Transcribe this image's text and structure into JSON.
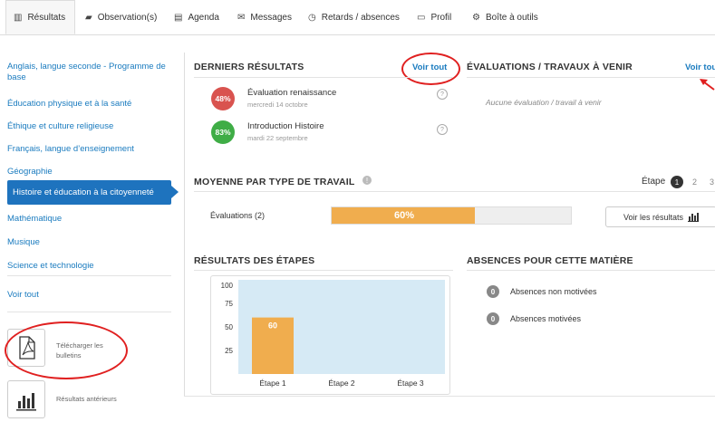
{
  "tabs": [
    {
      "label": "Résultats",
      "icon": "bar-chart-icon"
    },
    {
      "label": "Observation(s)",
      "icon": "folder-icon"
    },
    {
      "label": "Agenda",
      "icon": "calendar-icon"
    },
    {
      "label": "Messages",
      "icon": "envelope-icon"
    },
    {
      "label": "Retards / absences",
      "icon": "clock-icon"
    },
    {
      "label": "Profil",
      "icon": "id-card-icon"
    },
    {
      "label": "Boîte à outils",
      "icon": "tools-icon"
    }
  ],
  "sidebar": {
    "items": [
      {
        "label": "Anglais, langue seconde - Programme de base"
      },
      {
        "label": "Éducation physique et à la santé"
      },
      {
        "label": "Éthique et culture religieuse"
      },
      {
        "label": "Français, langue d’enseignement"
      },
      {
        "label": "Géographie"
      },
      {
        "label": "Histoire et éducation à la citoyenneté"
      },
      {
        "label": "Mathématique"
      },
      {
        "label": "Musique"
      },
      {
        "label": "Science et technologie"
      }
    ],
    "see_all": "Voir tout",
    "download_label": "Télécharger les bulletins",
    "previous_label": "Résultats antérieurs"
  },
  "recent": {
    "title": "DERNIERS RÉSULTATS",
    "see_all": "Voir tout",
    "items": [
      {
        "score": "48%",
        "title": "Évaluation renaissance",
        "date": "mercredi 14 octobre",
        "color": "#d9534f"
      },
      {
        "score": "83%",
        "title": "Introduction Histoire",
        "date": "mardi 22 septembre",
        "color": "#3fad46"
      }
    ]
  },
  "upcoming": {
    "title": "ÉVALUATIONS / TRAVAUX À VENIR",
    "see_all": "Voir tout",
    "empty": "Aucune évaluation / travail à venir"
  },
  "average": {
    "title": "MOYENNE PAR TYPE DE TRAVAIL",
    "step_label": "Étape",
    "steps": [
      "1",
      "2",
      "3"
    ],
    "row_label": "Évaluations (2)",
    "percent_text": "60%",
    "percent": 0.6,
    "view_button": "Voir les résultats",
    "bar_color": "#f0ad4e"
  },
  "stages": {
    "title": "RÉSULTATS DES ÉTAPES"
  },
  "absences": {
    "title": "ABSENCES POUR CETTE MATIÈRE",
    "unexcused_count": "0",
    "unexcused_label": "Absences non motivées",
    "excused_count": "0",
    "excused_label": "Absences motivées"
  },
  "chart_data": {
    "type": "bar",
    "categories": [
      "Étape 1",
      "Étape 2",
      "Étape 3"
    ],
    "values": [
      60,
      null,
      null
    ],
    "value_labels": [
      "60",
      "",
      ""
    ],
    "yticks": [
      "100",
      "75",
      "50",
      "25"
    ],
    "ylim": [
      0,
      100
    ],
    "bar_color": "#f0ad4e",
    "plot_bg": "#d6eaf5"
  }
}
